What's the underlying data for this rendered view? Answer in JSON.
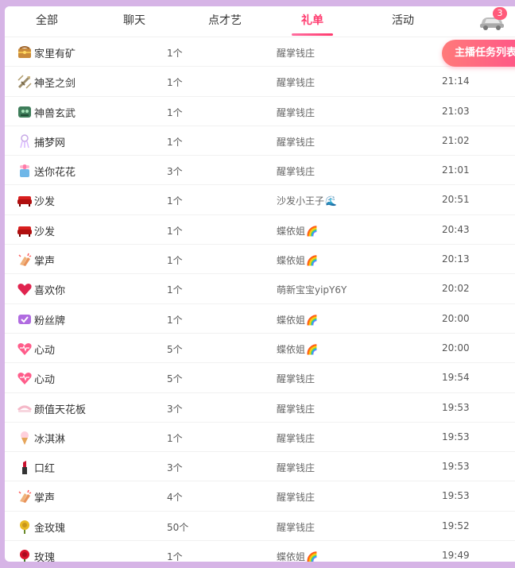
{
  "tabs": [
    {
      "label": "全部"
    },
    {
      "label": "聊天"
    },
    {
      "label": "点才艺"
    },
    {
      "label": "礼单"
    },
    {
      "label": "活动"
    }
  ],
  "car_badge": "3",
  "task_button": "主播任务列表",
  "rows": [
    {
      "icon": "treasure-box-icon",
      "name": "家里有矿",
      "count": "1个",
      "user": "醒掌钱庄",
      "user_emoji": "",
      "time": ""
    },
    {
      "icon": "sword-icon",
      "name": "神圣之剑",
      "count": "1个",
      "user": "醒掌钱庄",
      "user_emoji": "",
      "time": "21:14"
    },
    {
      "icon": "beast-icon",
      "name": "神兽玄武",
      "count": "1个",
      "user": "醒掌钱庄",
      "user_emoji": "",
      "time": "21:03"
    },
    {
      "icon": "dreamcatcher-icon",
      "name": "捕梦网",
      "count": "1个",
      "user": "醒掌钱庄",
      "user_emoji": "",
      "time": "21:02"
    },
    {
      "icon": "flower-gift-icon",
      "name": "送你花花",
      "count": "3个",
      "user": "醒掌钱庄",
      "user_emoji": "",
      "time": "21:01"
    },
    {
      "icon": "sofa-icon",
      "name": "沙发",
      "count": "1个",
      "user": "沙发小王子",
      "user_emoji": "🌊",
      "time": "20:51"
    },
    {
      "icon": "sofa-icon",
      "name": "沙发",
      "count": "1个",
      "user": "蝶依姐",
      "user_emoji": "🌈",
      "time": "20:43"
    },
    {
      "icon": "clap-icon",
      "name": "掌声",
      "count": "1个",
      "user": "蝶依姐",
      "user_emoji": "🌈",
      "time": "20:13"
    },
    {
      "icon": "heart-icon",
      "name": "喜欢你",
      "count": "1个",
      "user": "萌新宝宝yipY6Y",
      "user_emoji": "",
      "time": "20:02"
    },
    {
      "icon": "fan-badge-icon",
      "name": "粉丝牌",
      "count": "1个",
      "user": "蝶依姐",
      "user_emoji": "🌈",
      "time": "20:00"
    },
    {
      "icon": "heartbeat-icon",
      "name": "心动",
      "count": "5个",
      "user": "蝶依姐",
      "user_emoji": "🌈",
      "time": "20:00"
    },
    {
      "icon": "heartbeat-icon",
      "name": "心动",
      "count": "5个",
      "user": "醒掌钱庄",
      "user_emoji": "",
      "time": "19:54"
    },
    {
      "icon": "ceiling-icon",
      "name": "颜值天花板",
      "count": "3个",
      "user": "醒掌钱庄",
      "user_emoji": "",
      "time": "19:53"
    },
    {
      "icon": "ice-cream-icon",
      "name": "冰淇淋",
      "count": "1个",
      "user": "醒掌钱庄",
      "user_emoji": "",
      "time": "19:53"
    },
    {
      "icon": "lipstick-icon",
      "name": "口红",
      "count": "3个",
      "user": "醒掌钱庄",
      "user_emoji": "",
      "time": "19:53"
    },
    {
      "icon": "clap-icon",
      "name": "掌声",
      "count": "4个",
      "user": "醒掌钱庄",
      "user_emoji": "",
      "time": "19:53"
    },
    {
      "icon": "gold-rose-icon",
      "name": "金玫瑰",
      "count": "50个",
      "user": "醒掌钱庄",
      "user_emoji": "",
      "time": "19:52"
    },
    {
      "icon": "rose-icon",
      "name": "玫瑰",
      "count": "1个",
      "user": "蝶依姐",
      "user_emoji": "🌈",
      "time": "19:49"
    }
  ]
}
